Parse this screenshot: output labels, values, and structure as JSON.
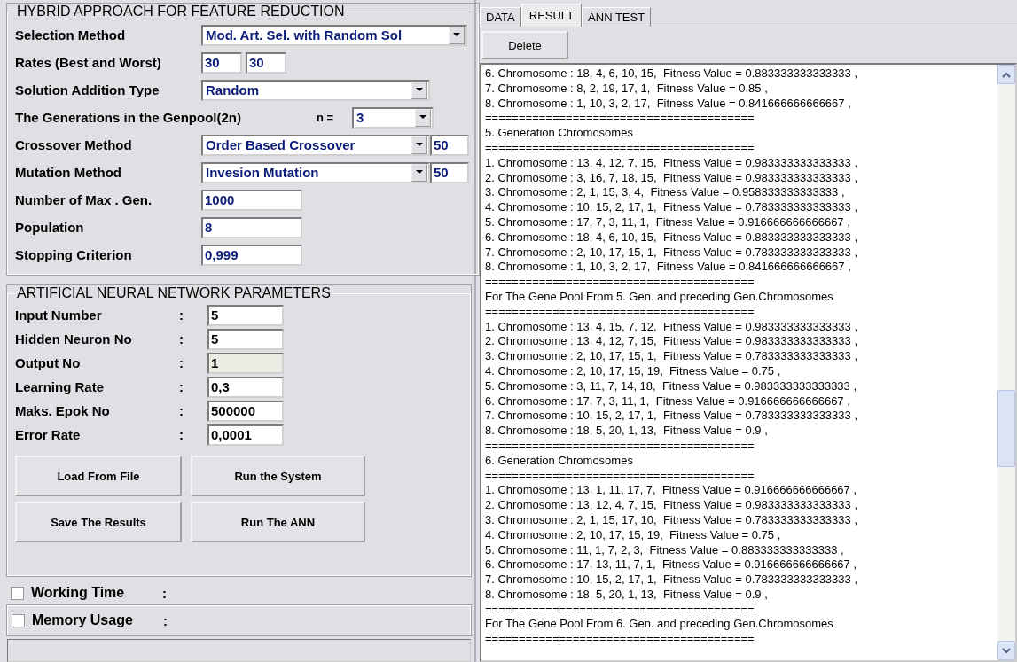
{
  "hybrid": {
    "title": "HYBRID APPROACH FOR FEATURE REDUCTION",
    "selection_method": {
      "label": "Selection Method",
      "value": "Mod. Art. Sel. with Random Sol"
    },
    "rates": {
      "label": "Rates (Best and Worst)",
      "best": "30",
      "worst": "30"
    },
    "solution_addition": {
      "label": "Solution Addition Type",
      "value": "Random"
    },
    "generations": {
      "label": "The Generations in the Genpool(2n)",
      "n_label": "n =",
      "value": "3"
    },
    "crossover": {
      "label": "Crossover Method",
      "value": "Order Based Crossover",
      "rate": "50"
    },
    "mutation": {
      "label": "Mutation Method",
      "value": "Invesion Mutation",
      "rate": "50"
    },
    "fields": [
      {
        "label": "Number of Max . Gen.",
        "value": "1000"
      },
      {
        "label": "Population",
        "value": "8"
      },
      {
        "label": "Stopping Criterion",
        "value": "0,999"
      }
    ]
  },
  "ann": {
    "title": "ARTIFICIAL NEURAL NETWORK PARAMETERS",
    "rows": [
      {
        "label": "Input Number",
        "separator": ":",
        "value": "5",
        "disabled": false
      },
      {
        "label": "Hidden Neuron No",
        "separator": ":",
        "value": "5",
        "disabled": false
      },
      {
        "label": "Output No",
        "separator": ":",
        "value": "1",
        "disabled": true
      },
      {
        "label": "Learning Rate",
        "separator": ":",
        "value": "0,3",
        "disabled": false
      },
      {
        "label": "Maks. Epok No",
        "separator": ":",
        "value": "500000",
        "disabled": false
      },
      {
        "label": "Error Rate",
        "separator": ":",
        "value": "0,0001",
        "disabled": false
      }
    ],
    "buttons": [
      "Load From File",
      "Run the System",
      "Save The Results",
      "Run The ANN"
    ]
  },
  "options": [
    {
      "label": "Working Time",
      "separator": ":",
      "checked": false
    },
    {
      "label": "Memory Usage",
      "separator": ":",
      "checked": false
    }
  ],
  "tabs": [
    {
      "label": "DATA",
      "selected": false
    },
    {
      "label": "RESULT",
      "selected": true
    },
    {
      "label": "ANN TEST",
      "selected": false
    }
  ],
  "delete_button": "Delete",
  "output_lines": [
    "6. Chromosome : 18, 4, 6, 10, 15,  Fitness Value = 0.883333333333333 ,",
    "7. Chromosome : 8, 2, 19, 17, 1,  Fitness Value = 0.85 ,",
    "8. Chromosome : 1, 10, 3, 2, 17,  Fitness Value = 0.841666666666667 ,",
    "========================================",
    "5. Generation Chromosomes",
    "========================================",
    "1. Chromosome : 13, 4, 12, 7, 15,  Fitness Value = 0.983333333333333 ,",
    "2. Chromosome : 3, 16, 7, 18, 15,  Fitness Value = 0.983333333333333 ,",
    "3. Chromosome : 2, 1, 15, 3, 4,  Fitness Value = 0.958333333333333 ,",
    "4. Chromosome : 10, 15, 2, 17, 1,  Fitness Value = 0.783333333333333 ,",
    "5. Chromosome : 17, 7, 3, 11, 1,  Fitness Value = 0.916666666666667 ,",
    "6. Chromosome : 18, 4, 6, 10, 15,  Fitness Value = 0.883333333333333 ,",
    "7. Chromosome : 2, 10, 17, 15, 1,  Fitness Value = 0.783333333333333 ,",
    "8. Chromosome : 1, 10, 3, 2, 17,  Fitness Value = 0.841666666666667 ,",
    "========================================",
    "For The Gene Pool From 5. Gen. and preceding Gen.Chromosomes",
    "========================================",
    "1. Chromosome : 13, 4, 15, 7, 12,  Fitness Value = 0.983333333333333 ,",
    "2. Chromosome : 13, 4, 12, 7, 15,  Fitness Value = 0.983333333333333 ,",
    "3. Chromosome : 2, 10, 17, 15, 1,  Fitness Value = 0.783333333333333 ,",
    "4. Chromosome : 2, 10, 17, 15, 19,  Fitness Value = 0.75 ,",
    "5. Chromosome : 3, 11, 7, 14, 18,  Fitness Value = 0.983333333333333 ,",
    "6. Chromosome : 17, 7, 3, 11, 1,  Fitness Value = 0.916666666666667 ,",
    "7. Chromosome : 10, 15, 2, 17, 1,  Fitness Value = 0.783333333333333 ,",
    "8. Chromosome : 18, 5, 20, 1, 13,  Fitness Value = 0.9 ,",
    "========================================",
    "6. Generation Chromosomes",
    "========================================",
    "1. Chromosome : 13, 1, 11, 17, 7,  Fitness Value = 0.916666666666667 ,",
    "2. Chromosome : 13, 12, 4, 7, 15,  Fitness Value = 0.983333333333333 ,",
    "3. Chromosome : 2, 1, 15, 17, 10,  Fitness Value = 0.783333333333333 ,",
    "4. Chromosome : 2, 10, 17, 15, 19,  Fitness Value = 0.75 ,",
    "5. Chromosome : 11, 1, 7, 2, 3,  Fitness Value = 0.883333333333333 ,",
    "6. Chromosome : 17, 13, 11, 7, 1,  Fitness Value = 0.916666666666667 ,",
    "7. Chromosome : 10, 15, 2, 17, 1,  Fitness Value = 0.783333333333333 ,",
    "8. Chromosome : 18, 5, 20, 1, 13,  Fitness Value = 0.9 ,",
    "========================================",
    "For The Gene Pool From 6. Gen. and preceding Gen.Chromosomes",
    "========================================"
  ]
}
